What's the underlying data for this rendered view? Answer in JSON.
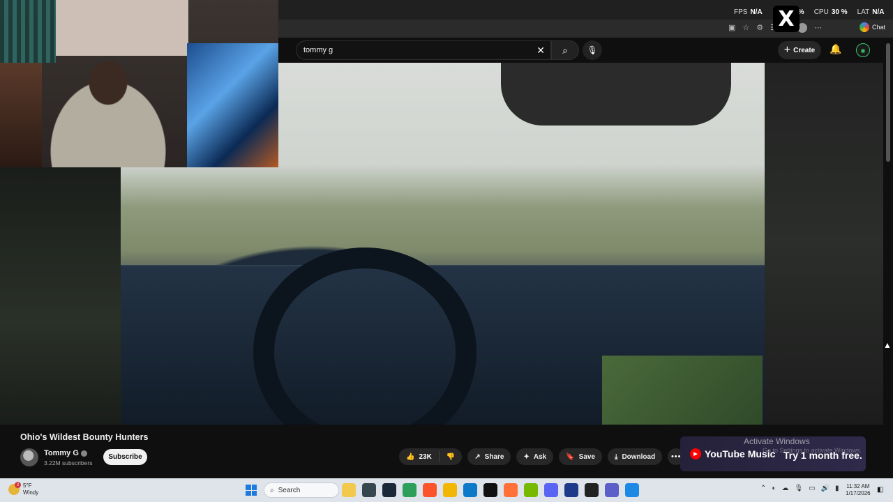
{
  "overlay": {
    "fps_label": "FPS",
    "fps_value": "N/A",
    "cpu_label": "CPU",
    "cpu_value": "30 %",
    "gpu_value_fragment": "%",
    "lat_label": "LAT",
    "lat_value": "N/A",
    "x_logo": "X"
  },
  "browser": {
    "chat_label": "Chat"
  },
  "youtube": {
    "search_query": "tommy g",
    "create_label": "Create",
    "video": {
      "title": "Ohio's Wildest Bounty Hunters",
      "channel_name": "Tommy G",
      "subscribers": "3.22M subscribers",
      "subscribe_label": "Subscribe",
      "likes": "23K",
      "share_label": "Share",
      "ask_label": "Ask",
      "save_label": "Save",
      "download_label": "Download"
    },
    "promo": {
      "brand": "YouTube Music",
      "cta": "Try 1 month free."
    }
  },
  "watermark": {
    "title": "Activate Windows",
    "subtitle": "Go to Settings to activate Windows."
  },
  "taskbar": {
    "weather_temp": "5°F",
    "weather_cond": "Windy",
    "weather_badge": "2",
    "search_label": "Search",
    "time": "11:32 AM",
    "date": "1/17/2026",
    "app_colors": [
      "#f2c94c",
      "#37474f",
      "#1b2838",
      "#2e9e5b",
      "#fb542b",
      "#f2b705",
      "#0d7ac9",
      "#111111",
      "#ff7139",
      "#76b900",
      "#5865f2",
      "#1e3a8a",
      "#222222",
      "#5b5fc7",
      "#1e88e5"
    ]
  }
}
